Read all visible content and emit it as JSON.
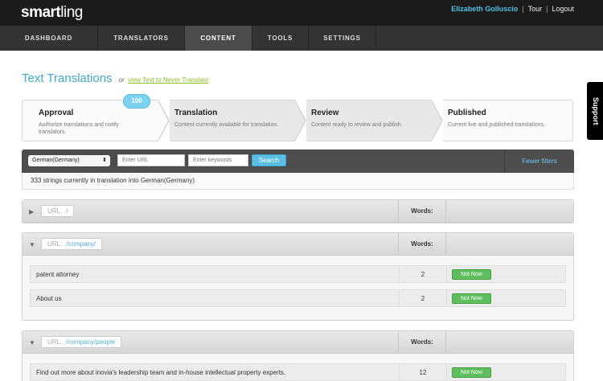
{
  "app": {
    "logo_bold": "smart",
    "logo_light": "ling"
  },
  "user": {
    "name": "Elizabeth Golluscio",
    "tour": "Tour",
    "logout": "Logout",
    "separator": "|"
  },
  "nav": [
    {
      "label": "DASHBOARD",
      "active": false
    },
    {
      "label": "TRANSLATORS",
      "active": false
    },
    {
      "label": "CONTENT",
      "active": true
    },
    {
      "label": "TOOLS",
      "active": false
    },
    {
      "label": "SETTINGS",
      "active": false
    }
  ],
  "support": {
    "label": "Support"
  },
  "page": {
    "title": "Text Translations",
    "or": "or",
    "link": "view Text to Never Translate"
  },
  "workflow": {
    "badge": "100",
    "steps": [
      {
        "title": "Approval",
        "desc": "Authorize translations and notify translators."
      },
      {
        "title": "Translation",
        "desc": "Content currently available for translation."
      },
      {
        "title": "Review",
        "desc": "Content ready to review and publish."
      },
      {
        "title": "Published",
        "desc": "Current live and published translations."
      }
    ]
  },
  "filters": {
    "language": "German(Germany)",
    "url_placeholder": "Enter URL",
    "keywords_placeholder": "Enter keywords",
    "search_label": "Search",
    "fewer_filters": "Fewer filters"
  },
  "summary": "333 strings currently in translation into German(Germany)",
  "groups": [
    {
      "url_key": "URL:",
      "url": "/",
      "words_label": "Words:",
      "expanded": false,
      "rows": []
    },
    {
      "url_key": "URL:",
      "url": "/company/",
      "words_label": "Words:",
      "expanded": true,
      "rows": [
        {
          "text": "patent attorney",
          "words": "2",
          "action": "Not Now"
        },
        {
          "text": "About us",
          "words": "2",
          "action": "Not Now"
        }
      ]
    },
    {
      "url_key": "URL:",
      "url": "/company/people",
      "words_label": "Words:",
      "expanded": true,
      "rows": [
        {
          "text": "Find out more about inovia's leadership team and in-house intellectual property experts.",
          "words": "12",
          "action": "Not Now"
        }
      ]
    }
  ],
  "colors": {
    "accent": "#41a9c9",
    "link_green": "#8dbf28",
    "button_green": "#5fbf5f",
    "search_blue": "#5bbfe2"
  }
}
